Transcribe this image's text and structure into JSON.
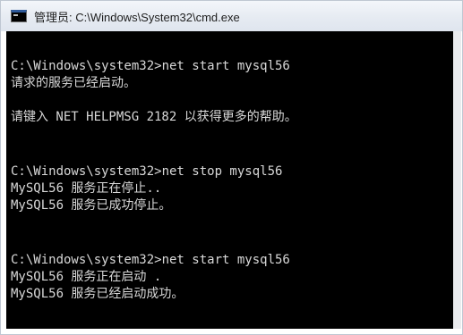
{
  "window": {
    "title": "管理员: C:\\Windows\\System32\\cmd.exe",
    "icon": "cmd-icon"
  },
  "console": {
    "lines": [
      "C:\\Windows\\system32>net start mysql56",
      "请求的服务已经启动。",
      "请键入 NET HELPMSG 2182 以获得更多的帮助。",
      "C:\\Windows\\system32>net stop mysql56",
      "MySQL56 服务正在停止..",
      "MySQL56 服务已成功停止。",
      "C:\\Windows\\system32>net start mysql56",
      "MySQL56 服务正在启动 .",
      "MySQL56 服务已经启动成功。"
    ]
  }
}
